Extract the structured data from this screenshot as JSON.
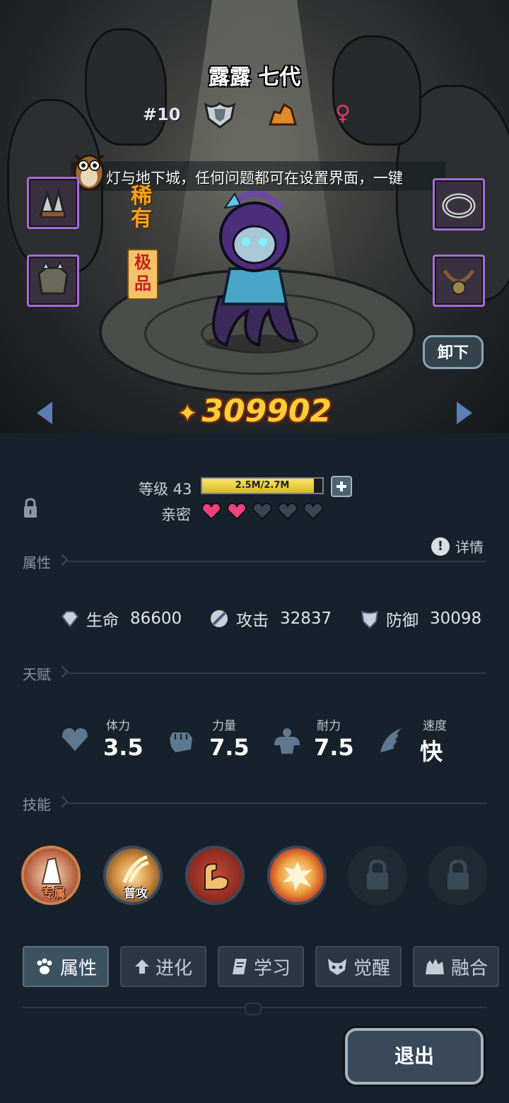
{
  "hero": {
    "name": "露露 七代",
    "rank": "#10",
    "gender_icon": "female-icon",
    "class_icon": "shield-icon",
    "element_icon": "rock-icon",
    "rarity": "稀有",
    "quality": "极品",
    "power": "309902"
  },
  "ticker": {
    "text": "灯与地下城，任何问题都可在设置界面，一键"
  },
  "buttons": {
    "unequip": "卸下",
    "exit": "退出"
  },
  "level": {
    "label": "等级 43",
    "exp_text": "2.5M/2.7M",
    "exp_progress": 0.93
  },
  "intimacy": {
    "label": "亲密",
    "filled": 2,
    "total": 5
  },
  "detail_label": "详情",
  "sections": {
    "attributes": "属性",
    "talent": "天赋",
    "skills": "技能"
  },
  "stats": [
    {
      "icon": "heart-gem-icon",
      "label": "生命",
      "value": "86600"
    },
    {
      "icon": "sword-icon",
      "label": "攻击",
      "value": "32837"
    },
    {
      "icon": "shield-icon",
      "label": "防御",
      "value": "30098"
    }
  ],
  "talents": [
    {
      "icon": "heart-icon",
      "label": "体力",
      "value": "3.5"
    },
    {
      "icon": "fist-icon",
      "label": "力量",
      "value": "7.5"
    },
    {
      "icon": "muscle-icon",
      "label": "耐力",
      "value": "7.5"
    },
    {
      "icon": "wing-icon",
      "label": "速度",
      "value": "快"
    }
  ],
  "skills": [
    {
      "icon": "exclusive-skill-icon",
      "tag": "专属"
    },
    {
      "icon": "claw-slash-icon",
      "tag": "普攻"
    },
    {
      "icon": "flex-arm-icon",
      "tag": ""
    },
    {
      "icon": "burst-icon",
      "tag": ""
    },
    {
      "icon": "lock-icon",
      "tag": ""
    },
    {
      "icon": "lock-icon",
      "tag": ""
    }
  ],
  "tabs": [
    {
      "icon": "paw-icon",
      "label": "属性"
    },
    {
      "icon": "arrow-up-icon",
      "label": "进化"
    },
    {
      "icon": "book-icon",
      "label": "学习"
    },
    {
      "icon": "mask-icon",
      "label": "觉醒"
    },
    {
      "icon": "merge-icon",
      "label": "融合"
    }
  ],
  "colors": {
    "accent_gold": "#ffce3a",
    "heart_pink": "#f0437a",
    "epic_purple": "#a46dd6",
    "panel_bg": "#17212b"
  }
}
